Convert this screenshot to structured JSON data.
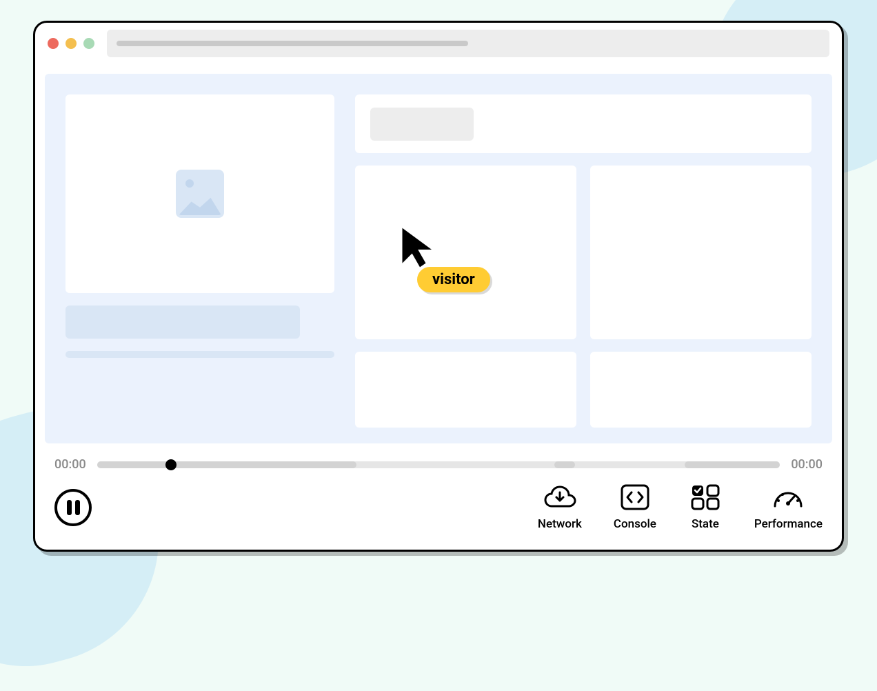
{
  "cursor": {
    "label": "visitor"
  },
  "timeline": {
    "start": "00:00",
    "end": "00:00",
    "progress_percent": 10
  },
  "tools": {
    "network": "Network",
    "console": "Console",
    "state": "State",
    "performance": "Performance"
  },
  "colors": {
    "accent_yellow": "#ffcc33",
    "canvas_bg": "#ebf2fd",
    "placeholder": "#d9e6f5"
  }
}
